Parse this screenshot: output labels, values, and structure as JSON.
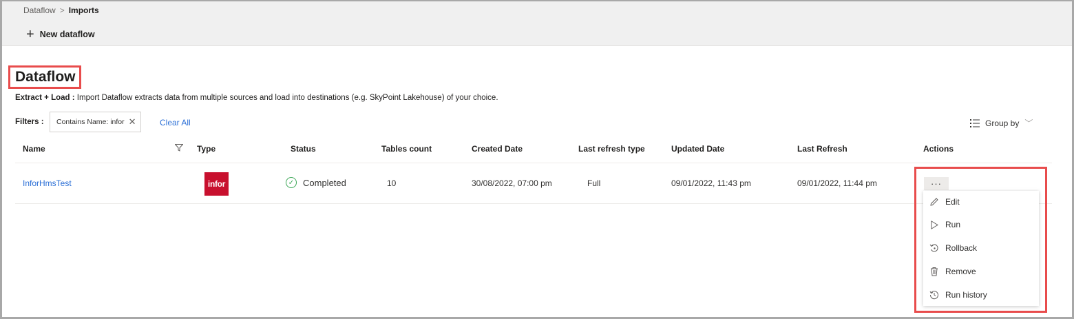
{
  "breadcrumb": {
    "parent": "Dataflow",
    "separator": ">",
    "current": "Imports"
  },
  "toolbar": {
    "new_label": "New dataflow"
  },
  "page": {
    "title": "Dataflow",
    "desc_bold": "Extract + Load :",
    "desc_text": " Import Dataflow extracts data from multiple sources and load into destinations (e.g. SkyPoint Lakehouse) of your choice."
  },
  "filters": {
    "label": "Filters :",
    "chip": "Contains Name: infor",
    "clear_all": "Clear All"
  },
  "group_by": {
    "label": "Group by"
  },
  "table": {
    "headers": {
      "name": "Name",
      "type": "Type",
      "status": "Status",
      "tables_count": "Tables count",
      "created_date": "Created Date",
      "last_refresh_type": "Last refresh type",
      "updated_date": "Updated Date",
      "last_refresh": "Last Refresh",
      "actions": "Actions"
    },
    "row": {
      "name": "InforHmsTest",
      "type_logo": "infor",
      "status": "Completed",
      "tables_count": "10",
      "created_date": "30/08/2022, 07:00 pm",
      "last_refresh_type": "Full",
      "updated_date": "09/01/2022, 11:43 pm",
      "last_refresh": "09/01/2022, 11:44 pm"
    }
  },
  "actions_menu": {
    "more": "···",
    "items": [
      "Edit",
      "Run",
      "Rollback",
      "Remove",
      "Run history"
    ]
  },
  "colors": {
    "link": "#2b6fd6",
    "highlight": "#e84c4c",
    "status_ok": "#3aa655",
    "infor_brand": "#c8102e"
  }
}
